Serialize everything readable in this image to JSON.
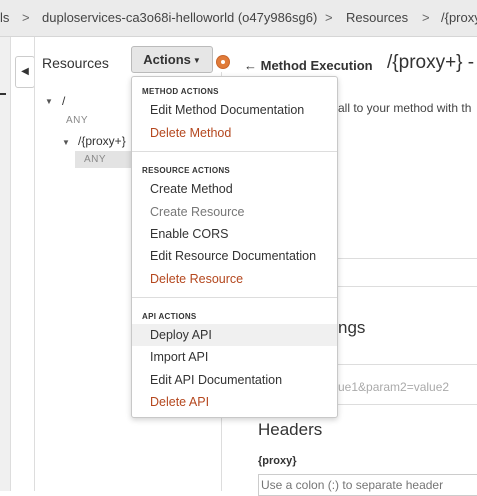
{
  "breadcrumb": {
    "items": [
      "ls",
      "duploservices-ca3o68i-helloworld (o47y986sg6)",
      "Resources",
      "/{proxy"
    ],
    "separator": ">"
  },
  "resources_panel": {
    "title": "Resources",
    "collapse_glyph": "◀",
    "actions_button": "Actions",
    "tree": {
      "root": "/",
      "root_method": "ANY",
      "child": "/{proxy+}",
      "child_method": "ANY"
    }
  },
  "actions_menu": {
    "method_actions": {
      "heading": "METHOD ACTIONS",
      "items": [
        "Edit Method Documentation",
        "Delete Method"
      ]
    },
    "resource_actions": {
      "heading": "RESOURCE ACTIONS",
      "items": [
        "Create Method",
        "Create Resource",
        "Enable CORS",
        "Edit Resource Documentation",
        "Delete Resource"
      ]
    },
    "api_actions": {
      "heading": "API ACTIONS",
      "items": [
        "Deploy API",
        "Import API",
        "Edit API Documentation",
        "Delete API"
      ]
    }
  },
  "method_panel": {
    "back_link": "Method Execution",
    "back_glyph": "←",
    "title": "/{proxy+} -",
    "description": "all to your method with th",
    "settings_heading": "ngs",
    "query_string_placeholder": "ue1&param2=value2",
    "headers_heading": "Headers",
    "proxy_label": "{proxy}",
    "header_placeholder": "Use a colon (:) to separate header"
  },
  "colors": {
    "danger_text": "#b4471e",
    "status_dot": "#e07b39",
    "topbar_bg": "#ebebeb"
  }
}
